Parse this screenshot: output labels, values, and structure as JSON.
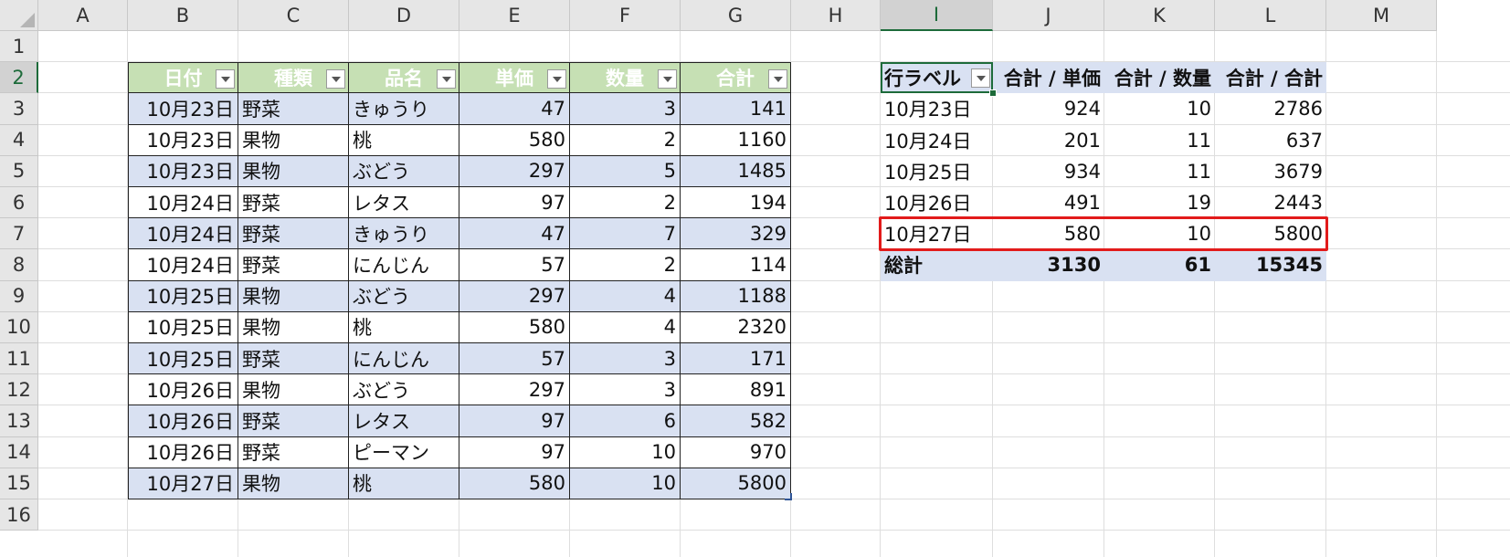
{
  "sheet": {
    "columns": [
      "A",
      "B",
      "C",
      "D",
      "E",
      "F",
      "G",
      "H",
      "I",
      "J",
      "K",
      "L",
      "M"
    ],
    "rows": [
      "1",
      "2",
      "3",
      "4",
      "5",
      "6",
      "7",
      "8",
      "9",
      "10",
      "11",
      "12",
      "13",
      "14",
      "15",
      "16"
    ],
    "selected_column": "I",
    "selected_row": "2"
  },
  "table": {
    "headers": [
      "日付",
      "種類",
      "品名",
      "単価",
      "数量",
      "合計"
    ],
    "rows": [
      [
        "10月23日",
        "野菜",
        "きゅうり",
        "47",
        "3",
        "141"
      ],
      [
        "10月23日",
        "果物",
        "桃",
        "580",
        "2",
        "1160"
      ],
      [
        "10月23日",
        "果物",
        "ぶどう",
        "297",
        "5",
        "1485"
      ],
      [
        "10月24日",
        "野菜",
        "レタス",
        "97",
        "2",
        "194"
      ],
      [
        "10月24日",
        "野菜",
        "きゅうり",
        "47",
        "7",
        "329"
      ],
      [
        "10月24日",
        "野菜",
        "にんじん",
        "57",
        "2",
        "114"
      ],
      [
        "10月25日",
        "果物",
        "ぶどう",
        "297",
        "4",
        "1188"
      ],
      [
        "10月25日",
        "果物",
        "桃",
        "580",
        "4",
        "2320"
      ],
      [
        "10月25日",
        "野菜",
        "にんじん",
        "57",
        "3",
        "171"
      ],
      [
        "10月26日",
        "果物",
        "ぶどう",
        "297",
        "3",
        "891"
      ],
      [
        "10月26日",
        "野菜",
        "レタス",
        "97",
        "6",
        "582"
      ],
      [
        "10月26日",
        "野菜",
        "ピーマン",
        "97",
        "10",
        "970"
      ],
      [
        "10月27日",
        "果物",
        "桃",
        "580",
        "10",
        "5800"
      ]
    ]
  },
  "pivot": {
    "headers": [
      "行ラベル",
      "合計 / 単価",
      "合計 / 数量",
      "合計 / 合計"
    ],
    "rows": [
      [
        "10月23日",
        "924",
        "10",
        "2786"
      ],
      [
        "10月24日",
        "201",
        "11",
        "637"
      ],
      [
        "10月25日",
        "934",
        "11",
        "3679"
      ],
      [
        "10月26日",
        "491",
        "19",
        "2443"
      ],
      [
        "10月27日",
        "580",
        "10",
        "5800"
      ]
    ],
    "total": [
      "総計",
      "3130",
      "61",
      "15345"
    ]
  },
  "colors": {
    "table_header": "#c6e0b4",
    "band": "#d9e1f2",
    "highlight": "#e21b1b",
    "selection": "#1d6b3a"
  }
}
